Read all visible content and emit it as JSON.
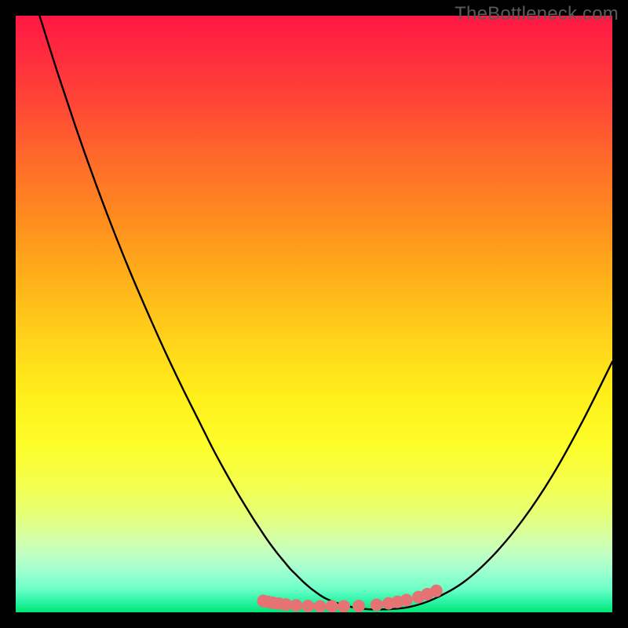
{
  "watermark": "TheBottleneck.com",
  "colors": {
    "black": "#000000",
    "curve_stroke": "#000000",
    "marker_fill": "#e57373",
    "gradient_top": "#ff1744",
    "gradient_bottom": "#00e676"
  },
  "chart_data": {
    "type": "line",
    "title": "",
    "xlabel": "",
    "ylabel": "",
    "xlim": [
      0,
      100
    ],
    "ylim": [
      0,
      100
    ],
    "series": [
      {
        "name": "bottleneck-curve",
        "x": [
          4,
          7,
          10,
          13,
          16,
          19,
          22,
          25,
          28,
          31,
          33,
          35,
          37,
          39,
          40,
          41,
          42,
          43,
          44,
          45,
          46,
          47,
          48,
          49,
          50,
          52,
          55,
          58,
          62,
          66,
          70,
          75,
          80,
          85,
          90,
          95,
          100
        ],
        "y": [
          100,
          90.5,
          81.5,
          73,
          65,
          57.5,
          50.5,
          43.8,
          37.5,
          31.5,
          27.5,
          23.8,
          20.3,
          17,
          15.4,
          13.9,
          12.4,
          11,
          9.7,
          8.5,
          7.3,
          6.3,
          5.3,
          4.4,
          3.6,
          2.3,
          1.2,
          0.6,
          0.5,
          0.9,
          2.2,
          5,
          9.5,
          15.5,
          23,
          32,
          42
        ]
      }
    ],
    "markers": {
      "name": "highlight-dots",
      "x": [
        41.5,
        42.3,
        43.1,
        44.1,
        45.3,
        47,
        49,
        51,
        53,
        55,
        57.5,
        60.5,
        62.5,
        64,
        65.5,
        67.5,
        69,
        70.5
      ],
      "y": [
        1.9,
        1.75,
        1.6,
        1.45,
        1.3,
        1.15,
        1.05,
        1.0,
        1.0,
        1.0,
        1.05,
        1.25,
        1.5,
        1.75,
        2.05,
        2.55,
        3.05,
        3.6
      ],
      "radius": 8
    }
  }
}
